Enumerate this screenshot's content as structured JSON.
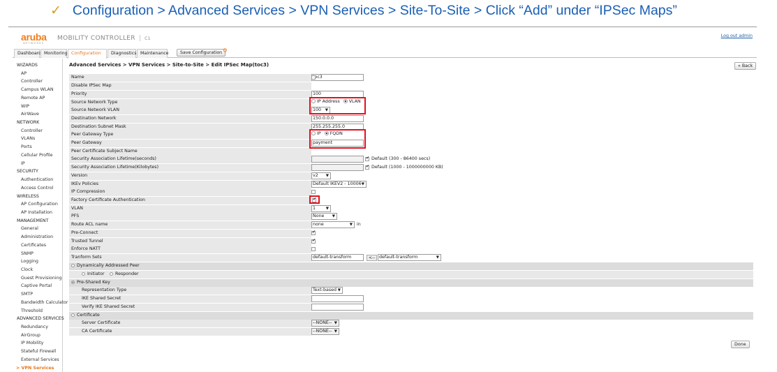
{
  "caption": {
    "check": "✓",
    "text": "Configuration > Advanced Services > VPN Services > Site-To-Site > Click “Add” under “IPSec Maps”"
  },
  "header": {
    "logo": "aruba",
    "logo_sub": "NETWORKS",
    "product": "MOBILITY CONTROLLER",
    "separator": "|",
    "controller": "C1",
    "logout": "Log out admin"
  },
  "tabs": [
    {
      "label": "Dashboard"
    },
    {
      "label": "Monitoring"
    },
    {
      "label": "Configuration",
      "active": true
    },
    {
      "label": "Diagnostics"
    },
    {
      "label": "Maintenance"
    }
  ],
  "save_config_label": "Save Configuration",
  "sidebar": [
    {
      "label": "WIZARDS",
      "kind": "cat"
    },
    {
      "label": "AP",
      "kind": "sub"
    },
    {
      "label": "Controller",
      "kind": "sub"
    },
    {
      "label": "Campus WLAN",
      "kind": "sub"
    },
    {
      "label": "Remote AP",
      "kind": "sub"
    },
    {
      "label": "WIP",
      "kind": "sub"
    },
    {
      "label": "AirWave",
      "kind": "sub"
    },
    {
      "label": "NETWORK",
      "kind": "cat"
    },
    {
      "label": "Controller",
      "kind": "sub"
    },
    {
      "label": "VLANs",
      "kind": "sub"
    },
    {
      "label": "Ports",
      "kind": "sub"
    },
    {
      "label": "Cellular Profile",
      "kind": "sub"
    },
    {
      "label": "IP",
      "kind": "sub"
    },
    {
      "label": "SECURITY",
      "kind": "cat"
    },
    {
      "label": "Authentication",
      "kind": "sub"
    },
    {
      "label": "Access Control",
      "kind": "sub"
    },
    {
      "label": "WIRELESS",
      "kind": "cat"
    },
    {
      "label": "AP Configuration",
      "kind": "sub"
    },
    {
      "label": "AP Installation",
      "kind": "sub"
    },
    {
      "label": "MANAGEMENT",
      "kind": "cat"
    },
    {
      "label": "General",
      "kind": "sub"
    },
    {
      "label": "Administration",
      "kind": "sub"
    },
    {
      "label": "Certificates",
      "kind": "sub"
    },
    {
      "label": "SNMP",
      "kind": "sub"
    },
    {
      "label": "Logging",
      "kind": "sub"
    },
    {
      "label": "Clock",
      "kind": "sub"
    },
    {
      "label": "Guest Provisioning",
      "kind": "sub"
    },
    {
      "label": "Captive Portal",
      "kind": "sub"
    },
    {
      "label": "SMTP",
      "kind": "sub"
    },
    {
      "label": "Bandwidth Calculator",
      "kind": "sub"
    },
    {
      "label": "Threshold",
      "kind": "sub"
    },
    {
      "label": "ADVANCED SERVICES",
      "kind": "cat"
    },
    {
      "label": "Redundancy",
      "kind": "sub"
    },
    {
      "label": "AirGroup",
      "kind": "sub"
    },
    {
      "label": "IP Mobility",
      "kind": "sub"
    },
    {
      "label": "Stateful Firewall",
      "kind": "sub"
    },
    {
      "label": "External Services",
      "kind": "sub"
    },
    {
      "label": "> VPN Services",
      "kind": "active"
    }
  ],
  "breadcrumb": "Advanced Services > VPN Services > Site-to-Site > Edit IPSec Map(toc3)",
  "back_label": "« Back",
  "done_label": "Done",
  "fields": {
    "name": {
      "label": "Name",
      "value": "toc3"
    },
    "disable": {
      "label": "Disable IPSec Map",
      "checked": false
    },
    "priority": {
      "label": "Priority",
      "value": "100"
    },
    "src_type": {
      "label": "Source Network Type",
      "opt1": "IP Address",
      "opt2": "VLAN",
      "selected": "VLAN"
    },
    "src_vlan": {
      "label": "Source Network VLAN",
      "value": "100"
    },
    "dest_net": {
      "label": "Destination Network",
      "value": "150.0.0.0"
    },
    "dest_mask": {
      "label": "Destination Subnet Mask",
      "value": "255.255.255.0"
    },
    "peer_type": {
      "label": "Peer Gateway Type",
      "opt1": "IP",
      "opt2": "FQDN",
      "selected": "FQDN"
    },
    "peer_gw": {
      "label": "Peer Gateway",
      "value": "payment"
    },
    "peer_cert": {
      "label": "Peer Certificate Subject Name"
    },
    "sa_sec": {
      "label": "Security Association Lifetime(seconds)",
      "default_label": "Default (300 - 86400 secs)",
      "checked": true
    },
    "sa_kb": {
      "label": "Security Association Lifetime(Kilobytes)",
      "default_label": "Default (1000 - 1000000000 KB)",
      "checked": true
    },
    "version": {
      "label": "Version",
      "value": "v2"
    },
    "ikev": {
      "label": "IKEv Policies",
      "value": "Default IKEV2 - 10006"
    },
    "ipcomp": {
      "label": "IP Compression",
      "checked": false
    },
    "factory": {
      "label": "Factory Certificate Authentication",
      "checked": true
    },
    "vlan": {
      "label": "VLAN",
      "value": "1"
    },
    "pfs": {
      "label": "PFS",
      "value": "None"
    },
    "route_acl": {
      "label": "Route ACL name",
      "value": "none",
      "suffix": "in"
    },
    "preconnect": {
      "label": "Pre-Connect",
      "checked": true
    },
    "trusted": {
      "label": "Trusted Tunnel",
      "checked": true
    },
    "natt": {
      "label": "Enforce NATT",
      "checked": false
    },
    "transform": {
      "label": "Tranform Sets",
      "value": "default-transform",
      "arrow": "<--",
      "select": "default-transform"
    }
  },
  "sections": {
    "dynamic": {
      "label": "Dynamically Addressed Peer",
      "initiator": "Initiator",
      "responder": "Responder"
    },
    "psk": {
      "label": "Pre-Shared Key"
    },
    "rep_type": {
      "label": "Representation Type",
      "value": "Text-based"
    },
    "ike_secret": {
      "label": "IKE Shared Secret"
    },
    "verify_secret": {
      "label": "Verify IKE Shared Secret"
    },
    "certificate": {
      "label": "Certificate"
    },
    "server_cert": {
      "label": "Server Certificate",
      "value": "--NONE--"
    },
    "ca_cert": {
      "label": "CA Certificate",
      "value": "--NONE--"
    }
  },
  "colors": {
    "accent": "#e8761b",
    "highlight": "#e0121f",
    "caption": "#1a5fb4"
  }
}
